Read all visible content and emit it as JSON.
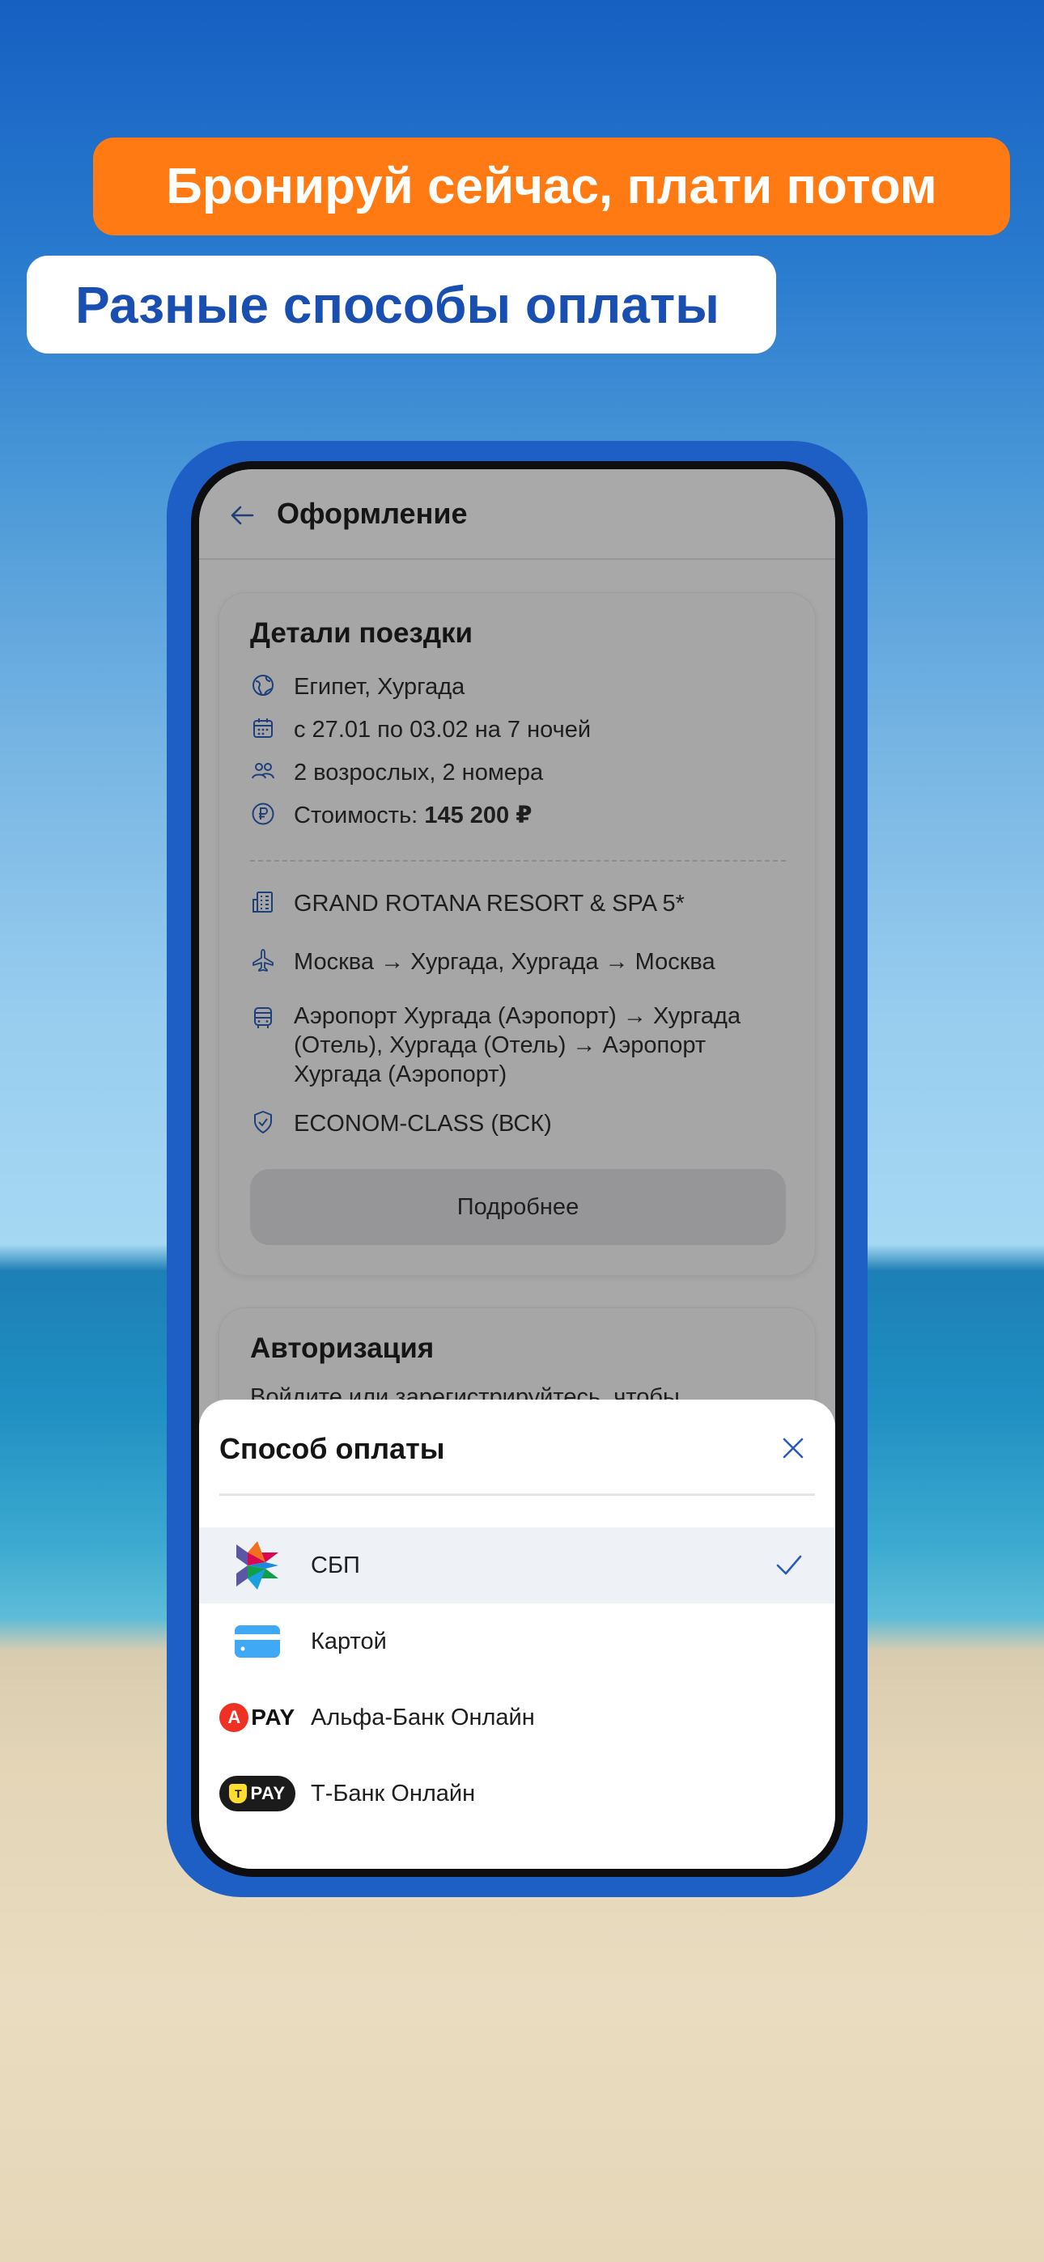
{
  "promo": {
    "headline": "Бронируй сейчас, плати потом",
    "subheadline": "Разные способы оплаты"
  },
  "header": {
    "title": "Оформление"
  },
  "trip": {
    "title": "Детали поездки",
    "destination": "Египет, Хургада",
    "dates": "с 27.01 по 03.02 на 7 ночей",
    "guests": "2 возрослых, 2 номера",
    "cost_label": "Стоимость: ",
    "cost_value": "145 200 ₽",
    "hotel": "GRAND ROTANA RESORT & SPA 5*",
    "flight": "Москва → Хургада, Хургада → Москва",
    "transfer": "Аэропорт Хургада (Аэропорт) → Хургада (Отель), Хургада (Отель) → Аэропорт Хургада (Аэропорт)",
    "insurance": "ECONOM-CLASS (ВСК)",
    "more_button": "Подробнее"
  },
  "auth": {
    "title": "Авторизация",
    "subtitle": "Войдите или зарегистрируйтесь, чтобы"
  },
  "payment_sheet": {
    "title": "Способ оплаты",
    "options": [
      {
        "label": "СБП",
        "icon": "sbp-logo-icon",
        "selected": true
      },
      {
        "label": "Картой",
        "icon": "card-icon",
        "selected": false
      },
      {
        "label": "Альфа-Банк Онлайн",
        "icon": "alfa-pay-icon",
        "badge": "PAY",
        "badge_letter": "А",
        "selected": false
      },
      {
        "label": "Т-Банк Онлайн",
        "icon": "tbank-pay-icon",
        "badge": "PAY",
        "badge_letter": "Т",
        "selected": false
      }
    ]
  },
  "colors": {
    "accent_orange": "#ff7a12",
    "brand_blue": "#1a4fb2",
    "phone_blue": "#1d5fc5",
    "check_blue": "#2b5bb8"
  }
}
